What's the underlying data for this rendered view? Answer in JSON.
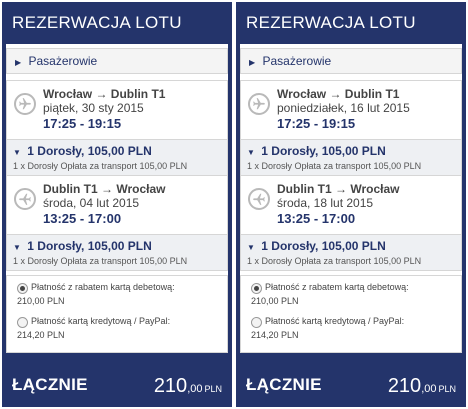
{
  "colors": {
    "brand": "#24346b",
    "fare_bg": "#eef0f3",
    "border": "#d6d6d6"
  },
  "panels": [
    {
      "title": "REZERWACJA LOTU",
      "passengers_label": "Pasażerowie",
      "outbound": {
        "icon": "plane-icon",
        "route": "Wrocław → Dublin T1",
        "date": "piątek, 30 sty 2015",
        "times": "17:25 - 19:15",
        "fare_head": "1 Dorosły, 105,00 PLN",
        "fare_line": "1 x Dorosły Opłata za transport 105,00 PLN"
      },
      "return": {
        "icon": "plane-icon",
        "route": "Dublin T1 → Wrocław",
        "date": "środa, 04 lut 2015",
        "times": "13:25 - 17:00",
        "fare_head": "1 Dorosły, 105,00 PLN",
        "fare_line": "1 x Dorosły Opłata za transport 105,00 PLN"
      },
      "payments": [
        {
          "label": "Płatność z rabatem kartą debetową:",
          "amount": "210,00 PLN",
          "selected": true
        },
        {
          "label": "Płatność kartą kredytową / PayPal:",
          "amount": "214,20 PLN",
          "selected": false
        }
      ],
      "total_label": "ŁĄCZNIE",
      "total_int": "210",
      "total_dec": ",00",
      "total_cur": "PLN"
    },
    {
      "title": "REZERWACJA LOTU",
      "passengers_label": "Pasażerowie",
      "outbound": {
        "icon": "plane-icon",
        "route": "Wrocław → Dublin T1",
        "date": "poniedziałek, 16 lut 2015",
        "times": "17:25 - 19:15",
        "fare_head": "1 Dorosły, 105,00 PLN",
        "fare_line": "1 x Dorosły Opłata za transport 105,00 PLN"
      },
      "return": {
        "icon": "plane-icon",
        "route": "Dublin T1 → Wrocław",
        "date": "środa, 18 lut 2015",
        "times": "13:25 - 17:00",
        "fare_head": "1 Dorosły, 105,00 PLN",
        "fare_line": "1 x Dorosły Opłata za transport 105,00 PLN"
      },
      "payments": [
        {
          "label": "Płatność z rabatem kartą debetową:",
          "amount": "210,00 PLN",
          "selected": true
        },
        {
          "label": "Płatność kartą kredytową / PayPal:",
          "amount": "214,20 PLN",
          "selected": false
        }
      ],
      "total_label": "ŁĄCZNIE",
      "total_int": "210",
      "total_dec": ",00",
      "total_cur": "PLN"
    }
  ]
}
